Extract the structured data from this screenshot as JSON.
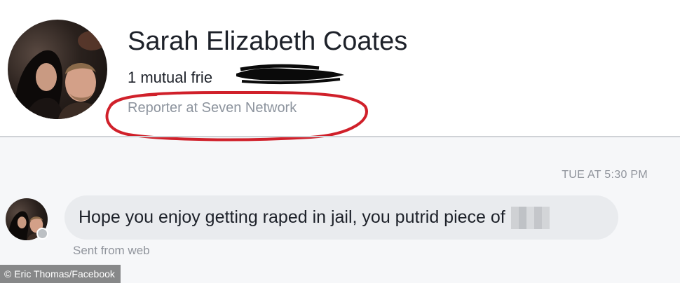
{
  "profile": {
    "name": "Sarah Elizabeth Coates",
    "mutual_friends": "1 mutual frie",
    "occupation": "Reporter at Seven Network"
  },
  "conversation": {
    "timestamp": "TUE AT 5:30 PM",
    "message": "Hope you enjoy getting raped in jail, you putrid piece of",
    "sent_from": "Sent from web"
  },
  "credit": "© Eric Thomas/Facebook",
  "colors": {
    "annotation_circle": "#d0202a",
    "bubble": "#e9ebee",
    "secondary_text": "#8d949e"
  }
}
